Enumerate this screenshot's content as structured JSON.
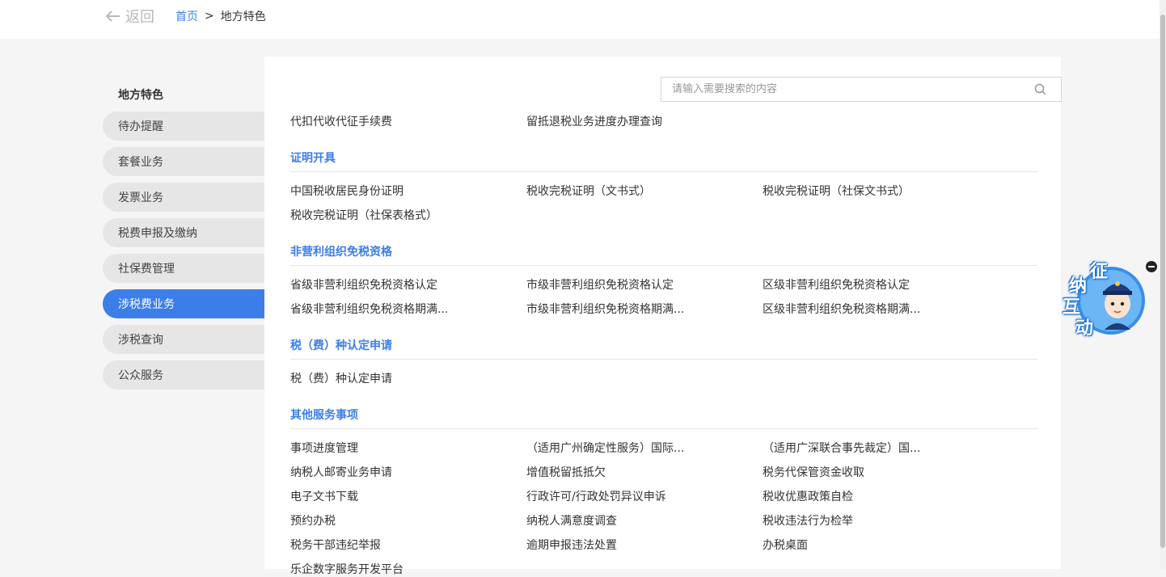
{
  "topbar": {
    "back_label": "返回",
    "breadcrumb": {
      "home": "首页",
      "separator": ">",
      "current": "地方特色"
    }
  },
  "sidebar": {
    "title": "地方特色",
    "items": [
      {
        "label": "待办提醒"
      },
      {
        "label": "套餐业务"
      },
      {
        "label": "发票业务"
      },
      {
        "label": "税费申报及缴纳"
      },
      {
        "label": "社保费管理"
      },
      {
        "label": "涉税费业务",
        "active": true
      },
      {
        "label": "涉税查询"
      },
      {
        "label": "公众服务"
      }
    ]
  },
  "search": {
    "placeholder": "请输入需要搜索的内容",
    "value": ""
  },
  "top_links": [
    "代扣代收代征手续费",
    "留抵退税业务进度办理查询"
  ],
  "sections": [
    {
      "title": "证明开具",
      "items": [
        "中国税收居民身份证明",
        "税收完税证明（文书式）",
        "税收完税证明（社保文书式）",
        "税收完税证明（社保表格式）"
      ]
    },
    {
      "title": "非营利组织免税资格",
      "items": [
        "省级非营利组织免税资格认定",
        "市级非营利组织免税资格认定",
        "区级非营利组织免税资格认定",
        "省级非营利组织免税资格期满...",
        "市级非营利组织免税资格期满...",
        "区级非营利组织免税资格期满..."
      ]
    },
    {
      "title": "税（费）种认定申请",
      "items": [
        "税（费）种认定申请"
      ]
    },
    {
      "title": "其他服务事项",
      "items": [
        "事项进度管理",
        "（适用广州确定性服务）国际...",
        "（适用广深联合事先裁定）国...",
        "纳税人邮寄业务申请",
        "增值税留抵抵欠",
        "税务代保管资金收取",
        "电子文书下载",
        "行政许可/行政处罚异议申诉",
        "税收优惠政策自检",
        "预约办税",
        "纳税人满意度调查",
        "税收违法行为检举",
        "税务干部违纪举报",
        "逾期申报违法处置",
        "办税桌面",
        "乐企数字服务开发平台"
      ]
    }
  ],
  "mascot": {
    "chars": [
      "征",
      "纳",
      "互",
      "动"
    ]
  }
}
